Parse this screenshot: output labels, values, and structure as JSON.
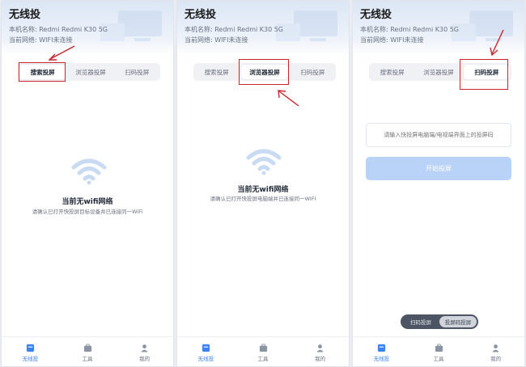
{
  "app": {
    "title": "无线投",
    "device_name": "本机名称:  Redmi Redmi K30 5G",
    "network": "当前网络:  WIFI未连接"
  },
  "tabs": [
    "搜索投屏",
    "浏览器投屏",
    "扫码投屏"
  ],
  "empty_state": {
    "title": "当前无wifi网络",
    "subtitle": "请确认已打开快投屏目标设备并已连接同一WiFi",
    "subtitle_browser": "请确认已打开快投屏电脑端并已连接同一WIFI"
  },
  "scan": {
    "code_placeholder": "请输入快投屏电脑端/电视端界面上的投屏码",
    "start_button": "开始投屏",
    "mode_options": [
      "扫码投屏",
      "投屏码投屏"
    ],
    "active_mode": "投屏码投屏"
  },
  "bottom_nav": [
    "无线投",
    "工具",
    "我的"
  ],
  "icons": {
    "wifi": "wifi-icon",
    "nav": [
      "cast-icon",
      "toolbox-icon",
      "user-icon"
    ]
  },
  "colors": {
    "accent": "#3b82f6",
    "highlight": "#c7252b",
    "start_button_disabled": "#b9d3f8",
    "wifi": "#c9dbf3"
  }
}
